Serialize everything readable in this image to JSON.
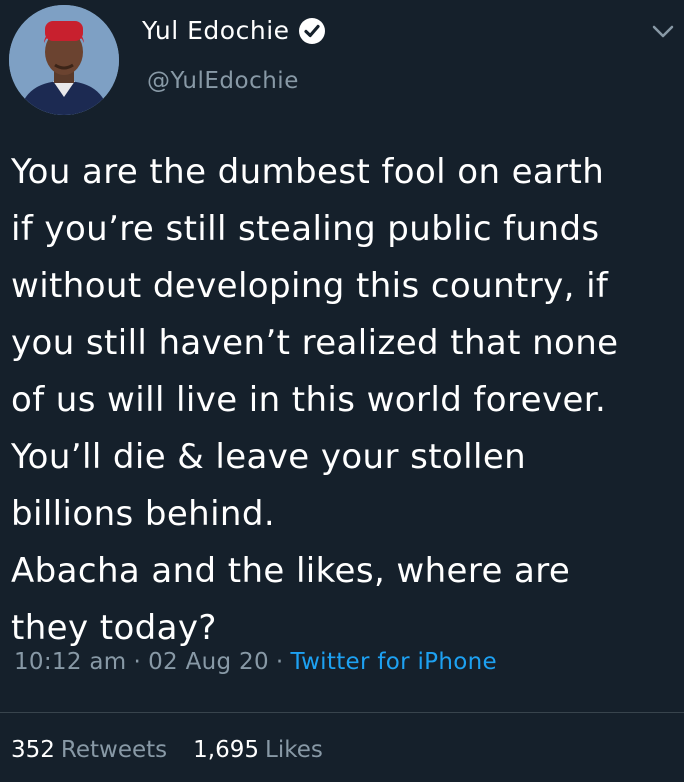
{
  "author": {
    "name": "Yul Edochie",
    "handle": "@YulEdochie",
    "verified": true,
    "avatar_icon": "profile-photo"
  },
  "tweet": {
    "text": "You are the dumbest fool on earth\nif you’re still stealing public funds\nwithout developing this country, if\nyou still haven’t realized that none\nof us will live in this world forever.\nYou’ll die & leave your stollen\nbillions behind.\nAbacha and the likes, where are\nthey today?",
    "time": "10:12 am",
    "date": "02 Aug 20",
    "separator": "·",
    "source": "Twitter for iPhone"
  },
  "stats": {
    "retweets_count": "352",
    "retweets_label": "Retweets",
    "likes_count": "1,695",
    "likes_label": "Likes"
  },
  "colors": {
    "background": "#15202b",
    "muted": "#8899a6",
    "accent": "#1da1f2"
  }
}
